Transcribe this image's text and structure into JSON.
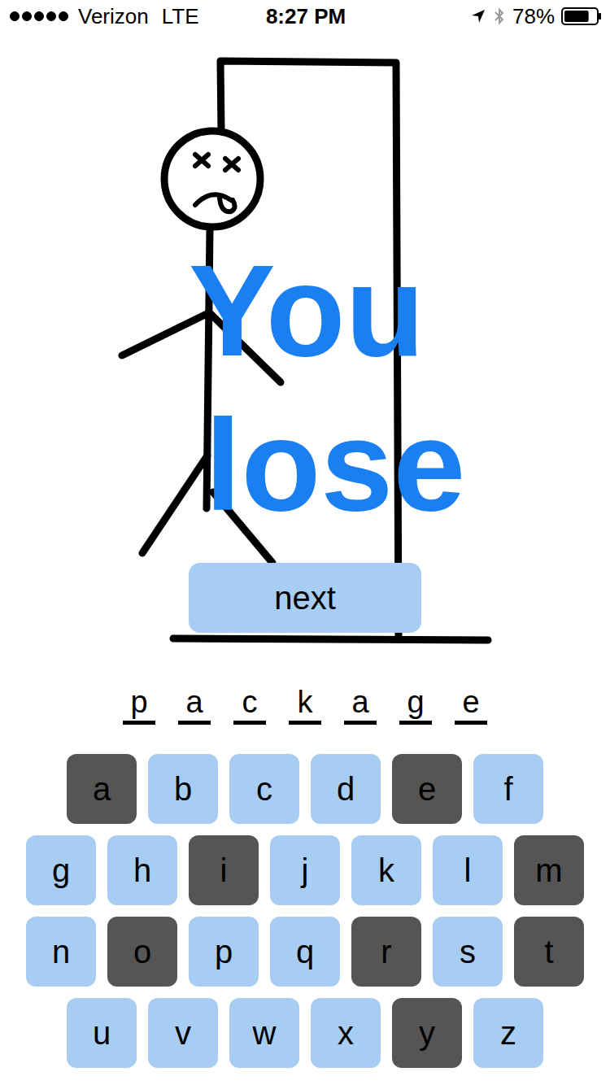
{
  "status_bar": {
    "signal": 1,
    "carrier": "Verizon",
    "network": "LTE",
    "time": "8:27 PM",
    "battery_text": "78%",
    "battery": 0.78
  },
  "game": {
    "lost": true,
    "message": [
      "You",
      "lose"
    ],
    "next_button": "next"
  },
  "word": [
    "p",
    "a",
    "c",
    "k",
    "a",
    "g",
    "e"
  ],
  "keyboard": {
    "rows": [
      [
        {
          "letter": "a",
          "used": true
        },
        {
          "letter": "b",
          "used": false
        },
        {
          "letter": "c",
          "used": false
        },
        {
          "letter": "d",
          "used": false
        },
        {
          "letter": "e",
          "used": true
        },
        {
          "letter": "f",
          "used": false
        }
      ],
      [
        {
          "letter": "g",
          "used": false
        },
        {
          "letter": "h",
          "used": false
        },
        {
          "letter": "i",
          "used": true
        },
        {
          "letter": "j",
          "used": false
        },
        {
          "letter": "k",
          "used": false
        },
        {
          "letter": "l",
          "used": false
        },
        {
          "letter": "m",
          "used": true
        }
      ],
      [
        {
          "letter": "n",
          "used": false
        },
        {
          "letter": "o",
          "used": true
        },
        {
          "letter": "p",
          "used": false
        },
        {
          "letter": "q",
          "used": false
        },
        {
          "letter": "r",
          "used": true
        },
        {
          "letter": "s",
          "used": false
        },
        {
          "letter": "t",
          "used": true
        }
      ],
      [
        {
          "letter": "u",
          "used": false
        },
        {
          "letter": "v",
          "used": false
        },
        {
          "letter": "w",
          "used": false
        },
        {
          "letter": "x",
          "used": false
        },
        {
          "letter": "y",
          "used": true
        },
        {
          "letter": "z",
          "used": false
        }
      ]
    ]
  }
}
